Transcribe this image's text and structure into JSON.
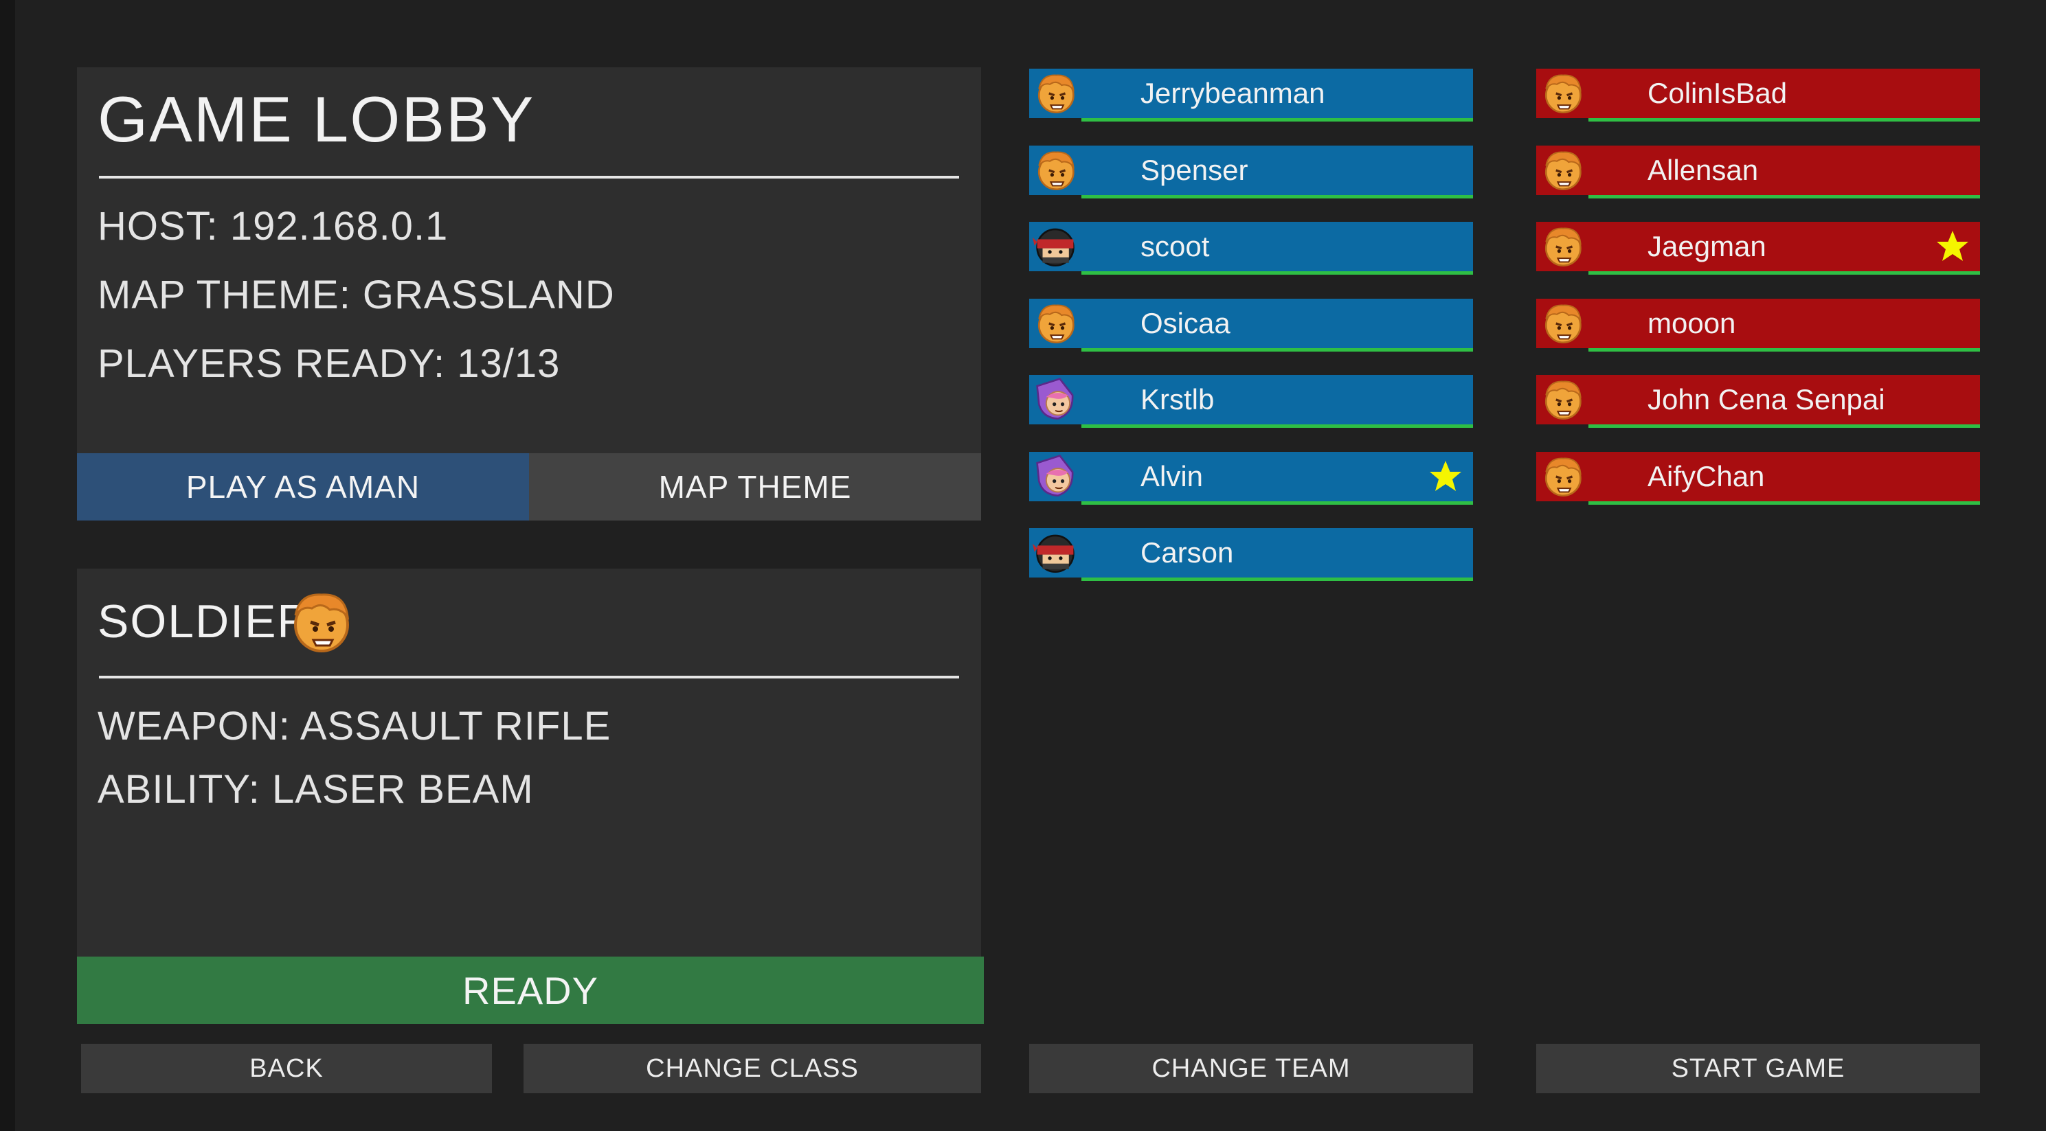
{
  "lobby": {
    "title": "GAME LOBBY",
    "host": "HOST: 192.168.0.1",
    "map_theme": "MAP THEME: GRASSLAND",
    "players_ready": "PLAYERS READY:  13/13",
    "play_as_label": "PLAY AS AMAN",
    "map_theme_button": "MAP THEME"
  },
  "class_panel": {
    "title": "SOLDIER",
    "avatar_icon": "soldier-face-icon",
    "weapon": "WEAPON: ASSAULT RIFLE",
    "ability": "ABILITY: LASER BEAM",
    "ready_label": "READY"
  },
  "colors": {
    "blue_team": "#0c6aa3",
    "red_team": "#a80d10",
    "ready_green": "#327a43",
    "play_as_blue": "#2d5078",
    "health_green": "#2fbf45",
    "star_yellow": "#f5f500"
  },
  "teams": {
    "blue": [
      {
        "name": "Jerrybeanman",
        "avatar": "soldier",
        "host": false
      },
      {
        "name": "Spenser",
        "avatar": "soldier",
        "host": false
      },
      {
        "name": "scoot",
        "avatar": "ninja",
        "host": false
      },
      {
        "name": "Osicaa",
        "avatar": "soldier",
        "host": false
      },
      {
        "name": "Krstlb",
        "avatar": "mage",
        "host": false
      },
      {
        "name": "Alvin",
        "avatar": "mage",
        "host": true
      },
      {
        "name": "Carson",
        "avatar": "ninja",
        "host": false
      }
    ],
    "red": [
      {
        "name": "ColinIsBad",
        "avatar": "soldier",
        "host": false
      },
      {
        "name": "Allensan",
        "avatar": "soldier",
        "host": false
      },
      {
        "name": "Jaegman",
        "avatar": "soldier",
        "host": true
      },
      {
        "name": "mooon",
        "avatar": "soldier",
        "host": false
      },
      {
        "name": "John Cena Senpai",
        "avatar": "soldier",
        "host": false
      },
      {
        "name": "AifyChan",
        "avatar": "soldier",
        "host": false
      }
    ]
  },
  "buttons": {
    "back": "BACK",
    "change_class": "CHANGE CLASS",
    "change_team": "CHANGE TEAM",
    "start_game": "START GAME"
  }
}
